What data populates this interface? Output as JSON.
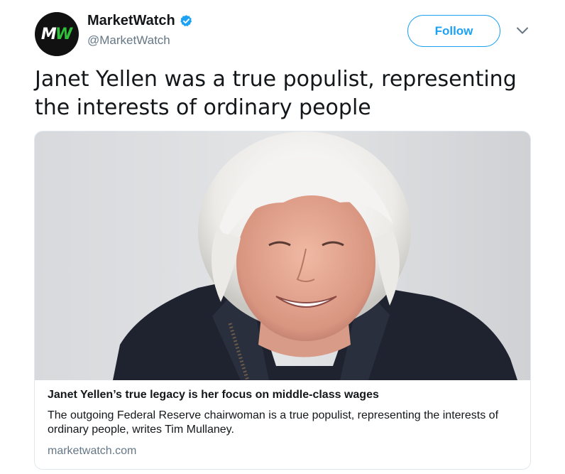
{
  "account": {
    "display_name": "MarketWatch",
    "handle": "@MarketWatch",
    "avatar_text": "MW",
    "verified": true
  },
  "follow_button": {
    "label": "Follow"
  },
  "tweet": {
    "text": "Janet Yellen was a true populist, representing the interests of ordinary people"
  },
  "card": {
    "title": "Janet Yellen’s true legacy is her focus on middle-class wages",
    "description": "The outgoing Federal Reserve chairwoman is a true populist, representing the interests of ordinary people, writes Tim Mullaney.",
    "domain": "marketwatch.com"
  },
  "icons": {
    "verified": "verified-badge-icon",
    "menu": "chevron-down-icon"
  },
  "colors": {
    "accent": "#1da1f2",
    "text": "#14171a",
    "muted": "#657786",
    "border": "#e1e8ed",
    "logo_green": "#2fbf3a"
  }
}
